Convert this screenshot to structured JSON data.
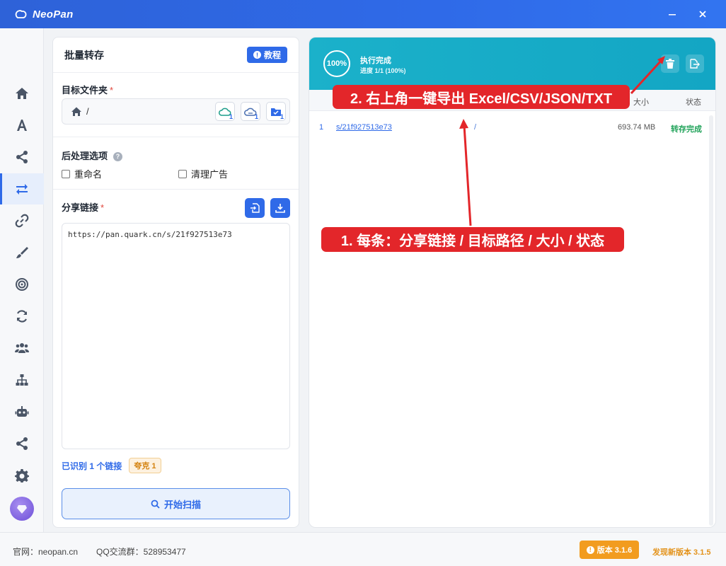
{
  "window": {
    "title": "NeoPan"
  },
  "left_panel": {
    "title": "批量转存",
    "tutorial_label": "教程",
    "target_folder_label": "目标文件夹",
    "required_mark": "*",
    "target_folder_path": "/",
    "count_badge_1": "1",
    "count_badge_2": "1",
    "count_badge_3": "1",
    "post_options_label": "后处理选项",
    "rename_label": "重命名",
    "clean_ads_label": "清理广告",
    "share_link_label": "分享链接",
    "share_link_value": "https://pan.quark.cn/s/21f927513e73",
    "recognized_text": "已识别 1 个链接",
    "quark_tag": "夸克 1",
    "scan_button": "开始扫描"
  },
  "right_panel": {
    "progress_percent": "100%",
    "status_text": "执行完成",
    "progress_text": "进度 1/1 (100%)",
    "columns": {
      "size": "大小",
      "status": "状态"
    },
    "rows": [
      {
        "index": "1",
        "share_link": "s/21f927513e73",
        "target_path": "/",
        "size": "693.74 MB",
        "status": "转存完成"
      }
    ]
  },
  "annotations": {
    "callout_export": "2. 右上角一键导出 Excel/CSV/JSON/TXT",
    "callout_fields": "1. 每条：分享链接 / 目标路径 / 大小 / 状态",
    "color": "#e3262a"
  },
  "statusbar": {
    "website": "官网：neopan.cn",
    "qq_group": "QQ交流群：528953477",
    "version": "版本 3.1.6",
    "new_version": "发现新版本 3.1.5"
  },
  "colors": {
    "accent": "#2f6ae8",
    "header_teal": "#13a6c4",
    "success": "#21a35a",
    "warning": "#f29c1f"
  },
  "icons": {
    "rail": [
      "home-icon",
      "font-icon",
      "share-icon",
      "transfer-icon",
      "link-icon",
      "brush-icon",
      "target-icon",
      "refresh-icon",
      "users-icon",
      "sitemap-icon",
      "robot-icon",
      "share-alt-icon",
      "gear-icon"
    ]
  }
}
